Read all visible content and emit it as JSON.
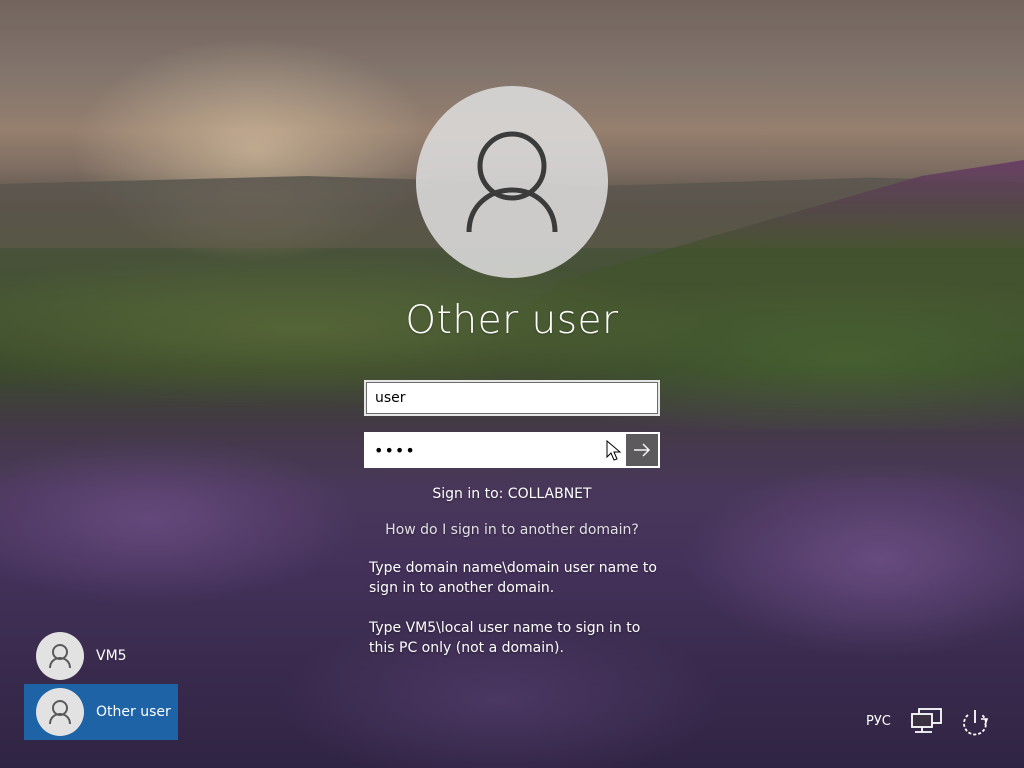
{
  "login": {
    "display_name": "Other user",
    "username_value": "user",
    "password_mask": "••••",
    "sign_in_to": "Sign in to: COLLABNET",
    "help_link": "How do I sign in to another domain?",
    "help_text_domain": "Type domain name\\domain user name to sign in to another domain.",
    "help_text_local": "Type VM5\\local user name to sign in to this PC only (not a domain)."
  },
  "users": [
    {
      "label": "VM5",
      "selected": false
    },
    {
      "label": "Other user",
      "selected": true
    }
  ],
  "system_tray": {
    "language": "РУС",
    "network_icon": "network-icon",
    "power_icon": "power-icon"
  },
  "colors": {
    "selected_user_background": "#1e63a6",
    "submit_button_background": "#5d5a5e"
  }
}
